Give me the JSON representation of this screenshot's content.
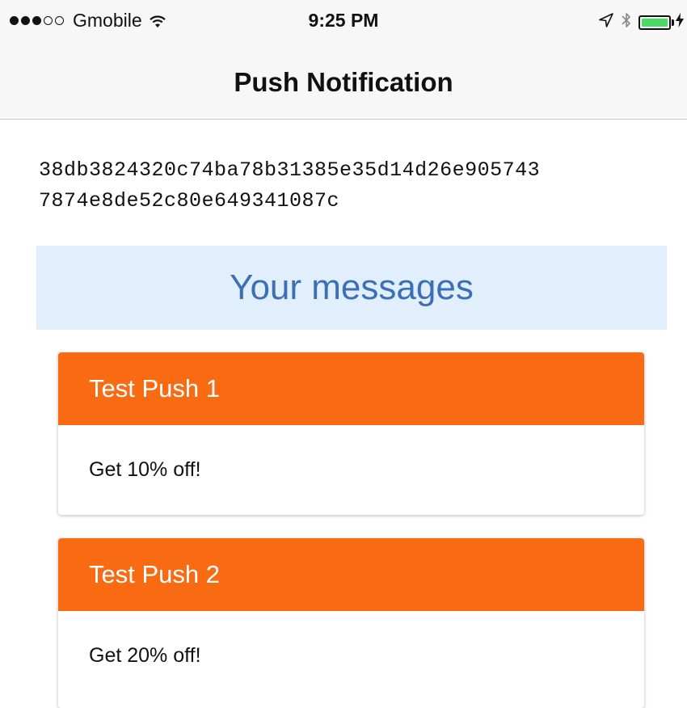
{
  "status_bar": {
    "signal_dots": [
      true,
      true,
      true,
      false,
      false
    ],
    "carrier": "Gmobile",
    "time": "9:25 PM",
    "battery_color": "#4cd964"
  },
  "nav": {
    "title": "Push Notification"
  },
  "device_token": {
    "line1": "38db3824320c74ba78b31385e35d14d26e905743",
    "line2": "7874e8de52c80e649341087c"
  },
  "messages": {
    "header": "Your messages",
    "items": [
      {
        "title": "Test Push 1",
        "body": "Get 10% off!"
      },
      {
        "title": "Test Push 2",
        "body": "Get 20% off!"
      }
    ]
  },
  "colors": {
    "card_header": "#f96b12",
    "messages_header_bg": "#e1effc",
    "messages_header_text": "#3d6fb8"
  }
}
